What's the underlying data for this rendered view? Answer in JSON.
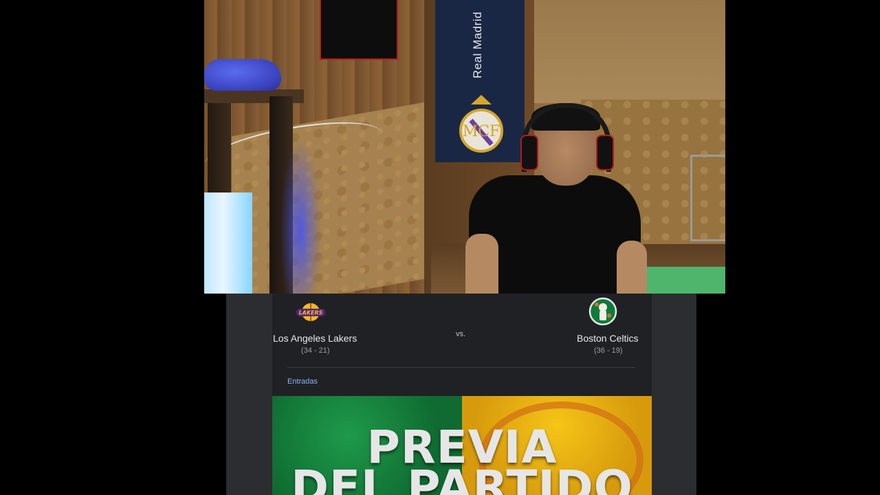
{
  "webcam": {
    "flag_text": "Real Madrid"
  },
  "game": {
    "home": {
      "name": "Los Angeles Lakers",
      "record": "(34 - 21)",
      "logo_text": "LAKERS"
    },
    "vs_label": "vs.",
    "away": {
      "name": "Boston Celtics",
      "record": "(36 - 19)"
    },
    "tab": "Entradas"
  },
  "promo": {
    "line1": "PREVIA",
    "line2": "DEL PARTIDO"
  },
  "colors": {
    "card_bg": "#202124",
    "link": "#8ab4f8",
    "celtics_green": "#0f6b31",
    "lakers_gold": "#f5c518"
  }
}
